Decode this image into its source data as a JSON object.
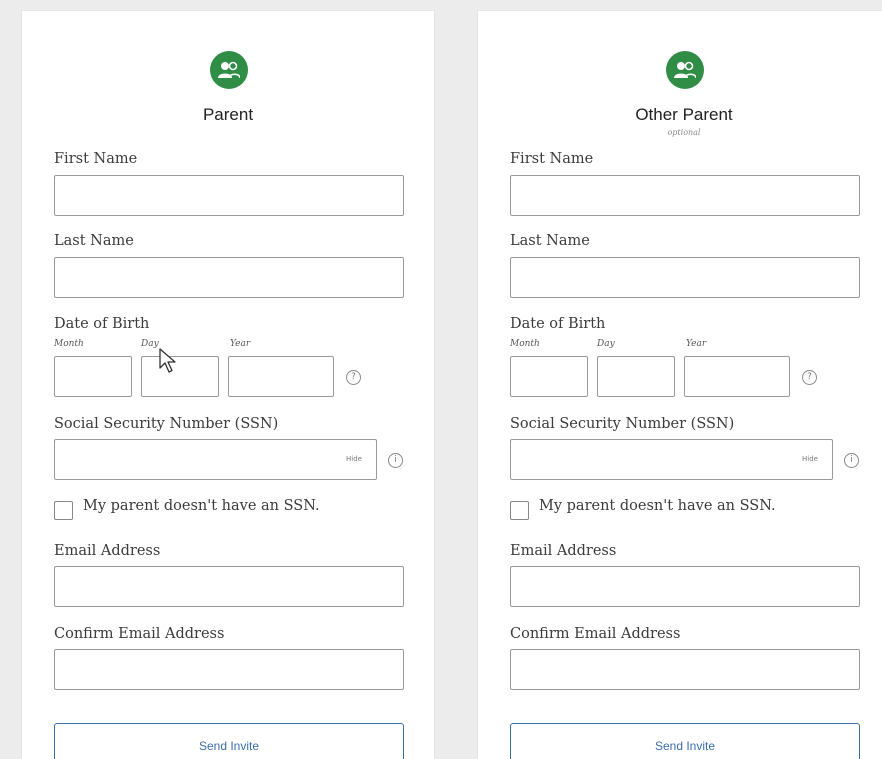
{
  "parent": {
    "title": "Parent",
    "first_name_label": "First Name",
    "last_name_label": "Last Name",
    "dob_label": "Date of Birth",
    "month_label": "Month",
    "day_label": "Day",
    "year_label": "Year",
    "help_glyph": "?",
    "ssn_label": "Social Security Number (SSN)",
    "ssn_hide_label": "Hide",
    "info_glyph": "i",
    "no_ssn_label": "My parent doesn't have an SSN.",
    "email_label": "Email Address",
    "confirm_email_label": "Confirm Email Address",
    "send_invite_label": "Send Invite"
  },
  "other_parent": {
    "title": "Other Parent",
    "subtitle": "optional",
    "first_name_label": "First Name",
    "last_name_label": "Last Name",
    "dob_label": "Date of Birth",
    "month_label": "Month",
    "day_label": "Day",
    "year_label": "Year",
    "help_glyph": "?",
    "ssn_label": "Social Security Number (SSN)",
    "ssn_hide_label": "Hide",
    "info_glyph": "i",
    "no_ssn_label": "My parent doesn't have an SSN.",
    "email_label": "Email Address",
    "confirm_email_label": "Confirm Email Address",
    "send_invite_label": "Send Invite"
  },
  "colors": {
    "avatar_green": "#2f8d46",
    "button_blue": "#3c6fb0"
  },
  "icons": {
    "avatar": "parent-users-icon",
    "cursor": "mouse-pointer-icon"
  }
}
